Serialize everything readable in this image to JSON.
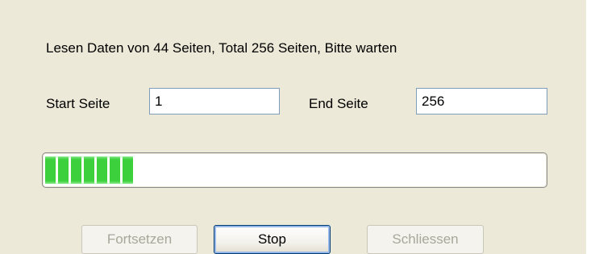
{
  "dialog": {
    "status_text": "Lesen Daten von 44 Seiten, Total 256 Seiten, Bitte warten",
    "start_page": {
      "label": "Start Seite",
      "value": "1"
    },
    "end_page": {
      "label": "End Seite",
      "value": "256"
    },
    "progress": {
      "value": 0.19
    },
    "buttons": {
      "continue_label": "Fortsetzen",
      "stop_label": "Stop",
      "close_label": "Schliessen"
    },
    "colors": {
      "dialog_background": "#ece9d8",
      "progress_green": "#3cd13c",
      "input_border": "#7f9db9",
      "disabled_text": "#a9a69a",
      "focus_border": "#003c74"
    }
  }
}
